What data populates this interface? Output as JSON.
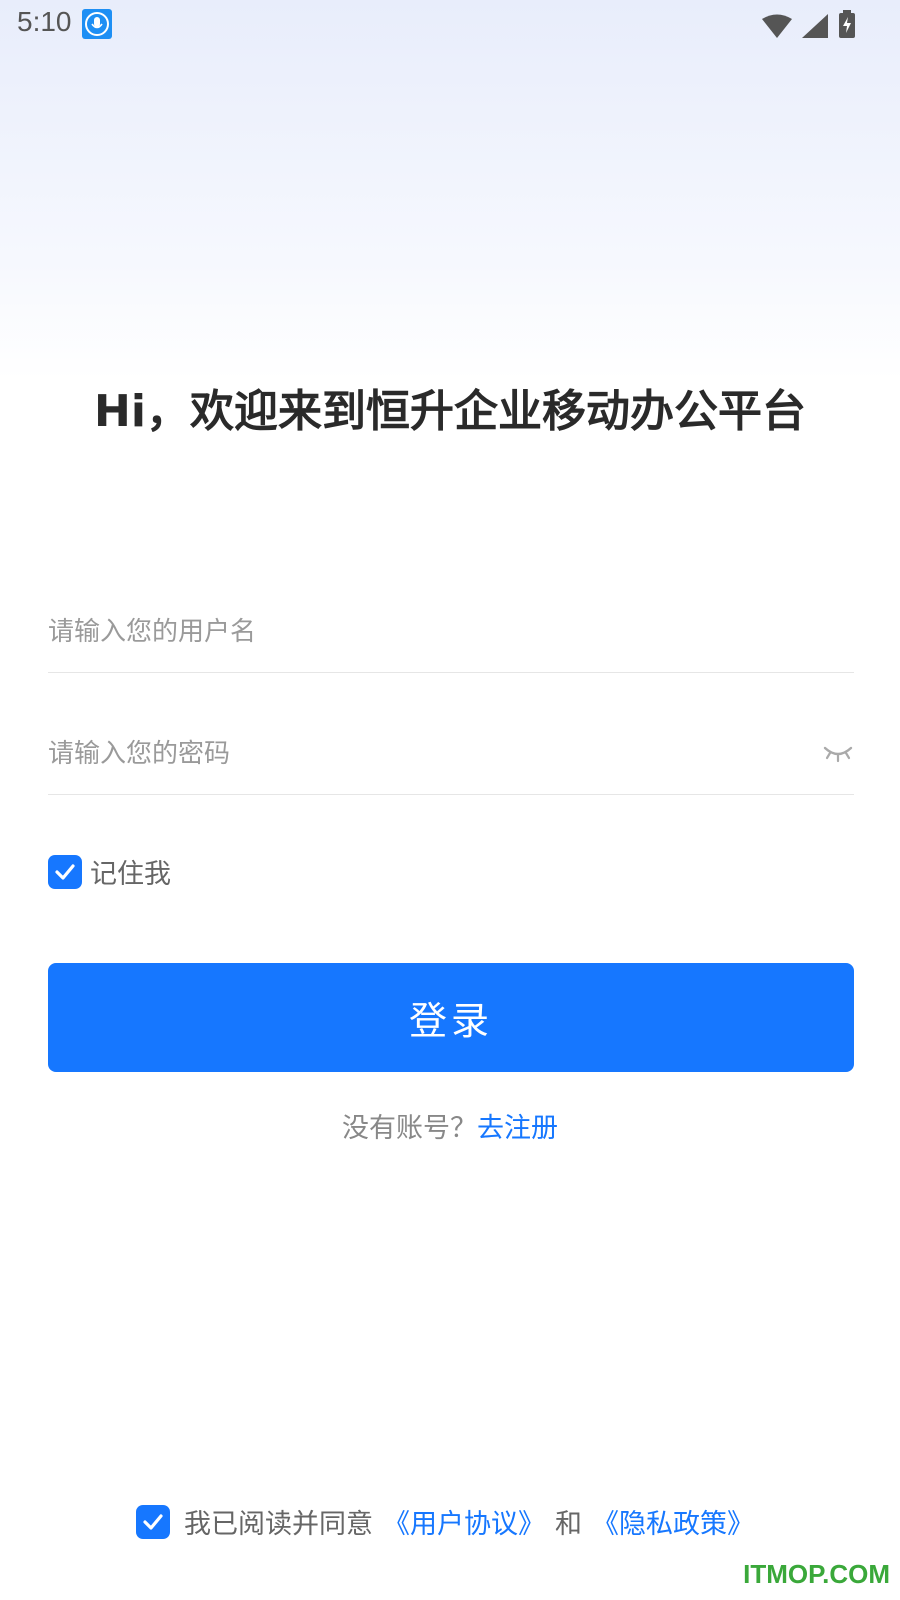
{
  "status_bar": {
    "time": "5:10"
  },
  "header": {
    "title": "Hi，欢迎来到恒升企业移动办公平台"
  },
  "form": {
    "username_placeholder": "请输入您的用户名",
    "password_placeholder": "请输入您的密码",
    "remember_label": "记住我",
    "remember_checked": true,
    "login_label": "登录"
  },
  "register": {
    "prompt": "没有账号？",
    "link": "去注册"
  },
  "agreement": {
    "text": "我已阅读并同意",
    "user_agreement": "《用户协议》",
    "and": "和",
    "privacy_policy": "《隐私政策》",
    "checked": true
  },
  "watermark": "ITMOP.COM",
  "colors": {
    "accent": "#1677ff",
    "watermark": "#3aa83a"
  }
}
